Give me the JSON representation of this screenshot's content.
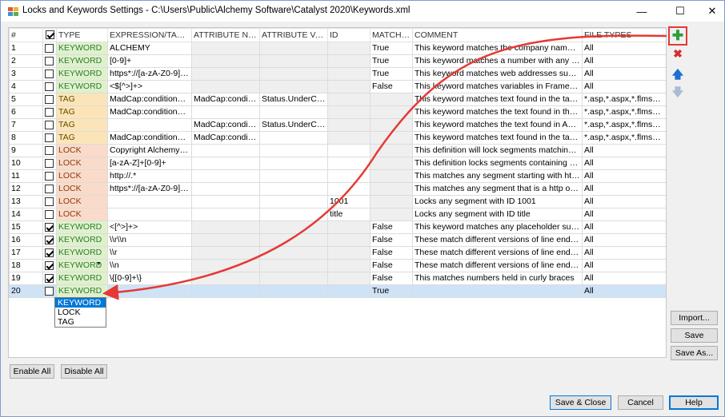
{
  "window": {
    "title": "Locks and Keywords Settings - C:\\Users\\Public\\Alchemy Software\\Catalyst 2020\\Keywords.xml",
    "minimize_glyph": "—",
    "maximize_glyph": "☐",
    "close_glyph": "✕"
  },
  "grid": {
    "columns": [
      "#",
      "",
      "TYPE",
      "EXPRESSION/TAG NA...",
      "ATTRIBUTE NAME",
      "ATTRIBUTE VALUE",
      "ID",
      "MATCH ...",
      "COMMENT",
      "FILE TYPES"
    ],
    "header_checkbox_checked": true,
    "rows": [
      {
        "num": "1",
        "checked": false,
        "type": "KEYWORD",
        "expr": "ALCHEMY",
        "attr_name": "",
        "attr_value": "",
        "id": "",
        "match": "True",
        "comment": "This keyword matches the company name Alchemy",
        "files": "All"
      },
      {
        "num": "2",
        "checked": false,
        "type": "KEYWORD",
        "expr": "[0-9]+",
        "attr_name": "",
        "attr_value": "",
        "id": "",
        "match": "True",
        "comment": "This keyword matches a number with any number of digits",
        "files": "All"
      },
      {
        "num": "3",
        "checked": false,
        "type": "KEYWORD",
        "expr": "https*://[a-zA-Z0-9]+\\...",
        "attr_name": "",
        "attr_value": "",
        "id": "",
        "match": "True",
        "comment": "This keyword matches web addresses such as http",
        "files": "All"
      },
      {
        "num": "4",
        "checked": false,
        "type": "KEYWORD",
        "expr": "<$[^>]+>",
        "attr_name": "",
        "attr_value": "",
        "id": "",
        "match": "False",
        "comment": "This keyword matches variables in FrameMaker",
        "files": "All"
      },
      {
        "num": "5",
        "checked": false,
        "type": "TAG",
        "expr": "MadCap:conditionalText",
        "attr_name": "MadCap:conditions",
        "attr_value": "Status.UnderConstruction",
        "id": "",
        "match": "",
        "comment": "This keyword matches text found in the tag MadCap",
        "files": "*.asp,*.aspx,*.flmsp,*.flsnp"
      },
      {
        "num": "6",
        "checked": false,
        "type": "TAG",
        "expr": "MadCap:conditionalText",
        "attr_name": "",
        "attr_value": "",
        "id": "",
        "match": "",
        "comment": "This keyword matches the text found in the tag MadCap",
        "files": "*.asp,*.aspx,*.flmsp,*.flsnp"
      },
      {
        "num": "7",
        "checked": false,
        "type": "TAG",
        "expr": "",
        "attr_name": "MadCap:conditions",
        "attr_value": "Status.UnderConstruction",
        "id": "",
        "match": "",
        "comment": "This keyword matches the text found in ANY tag",
        "files": "*.asp,*.aspx,*.flmsp,*.flsnp"
      },
      {
        "num": "8",
        "checked": false,
        "type": "TAG",
        "expr": "MadCap:conditionalText",
        "attr_name": "MadCap:conditions",
        "attr_value": "",
        "id": "",
        "match": "",
        "comment": "This keyword matches text found in the tag MadCap",
        "files": "*.asp,*.aspx,*.flmsp,*.flsnp"
      },
      {
        "num": "9",
        "checked": false,
        "type": "LOCK",
        "expr": "Copyright Alchemy Software",
        "attr_name": "",
        "attr_value": "",
        "id": "",
        "match": "",
        "comment": " This definition will lock segments matching text",
        "files": "All"
      },
      {
        "num": "10",
        "checked": false,
        "type": "LOCK",
        "expr": "[a-zA-Z]+[0-9]+",
        "attr_name": "",
        "attr_value": "",
        "id": "",
        "match": "",
        "comment": "This definition locks segments containing uppercase",
        "files": "All"
      },
      {
        "num": "11",
        "checked": false,
        "type": "LOCK",
        "expr": "http://.*",
        "attr_name": "",
        "attr_value": "",
        "id": "",
        "match": "",
        "comment": "This matches any segment starting with http://",
        "files": "All"
      },
      {
        "num": "12",
        "checked": false,
        "type": "LOCK",
        "expr": "https*://[a-zA-Z0-9]+\\...",
        "attr_name": "",
        "attr_value": "",
        "id": "",
        "match": "",
        "comment": "This matches any segment that is a http or https",
        "files": "All"
      },
      {
        "num": "13",
        "checked": false,
        "type": "LOCK",
        "expr": "",
        "attr_name": "",
        "attr_value": "",
        "id": "1001",
        "match": "",
        "comment": "Locks any segment with ID 1001",
        "files": "All"
      },
      {
        "num": "14",
        "checked": false,
        "type": "LOCK",
        "expr": "",
        "attr_name": "",
        "attr_value": "",
        "id": "title",
        "match": "",
        "comment": "Locks any segment with ID title",
        "files": "All"
      },
      {
        "num": "15",
        "checked": true,
        "type": "KEYWORD",
        "expr": "<[^>]+>",
        "attr_name": "",
        "attr_value": "",
        "id": "",
        "match": "False",
        "comment": "This keyword matches any placeholder surrounded",
        "files": "All"
      },
      {
        "num": "16",
        "checked": true,
        "type": "KEYWORD",
        "expr": "\\\\r\\\\n",
        "attr_name": "",
        "attr_value": "",
        "id": "",
        "match": "False",
        "comment": "These match different versions of line endings that",
        "files": "All"
      },
      {
        "num": "17",
        "checked": true,
        "type": "KEYWORD",
        "expr": "\\\\r",
        "attr_name": "",
        "attr_value": "",
        "id": "",
        "match": "False",
        "comment": "These match different versions of line endings that",
        "files": "All"
      },
      {
        "num": "18",
        "checked": true,
        "type": "KEYWORD",
        "expr": "\\\\n",
        "attr_name": "",
        "attr_value": "",
        "id": "",
        "match": "False",
        "comment": "These match different versions of line endings that",
        "files": "All"
      },
      {
        "num": "19",
        "checked": true,
        "type": "KEYWORD",
        "expr": "\\{[0-9]+\\}",
        "attr_name": "",
        "attr_value": "",
        "id": "",
        "match": "False",
        "comment": "This matches numbers held in curly braces",
        "files": "All"
      },
      {
        "num": "20",
        "checked": false,
        "type": "KEYWORD",
        "expr": "",
        "attr_name": "",
        "attr_value": "",
        "id": "",
        "match": "True",
        "comment": "",
        "files": "All",
        "editing": true
      }
    ],
    "dropdown_options": [
      "KEYWORD",
      "LOCK",
      "TAG"
    ],
    "dropdown_selected": "KEYWORD"
  },
  "side_buttons": {
    "add_glyph": "✚",
    "delete_glyph": "✖",
    "up_glyph": "🡅",
    "down_glyph": "🡇"
  },
  "buttons": {
    "import": "Import...",
    "save": "Save",
    "save_as": "Save As...",
    "enable_all": "Enable All",
    "disable_all": "Disable All",
    "save_close": "Save & Close",
    "cancel": "Cancel",
    "help": "Help"
  },
  "colors": {
    "keyword_bg": "#dff1cc",
    "tag_bg": "#fbe5b8",
    "lock_bg": "#fadbc9",
    "annotation_red": "#e53935",
    "add_green": "#2e9e3a",
    "selection_blue": "#0078d7"
  }
}
